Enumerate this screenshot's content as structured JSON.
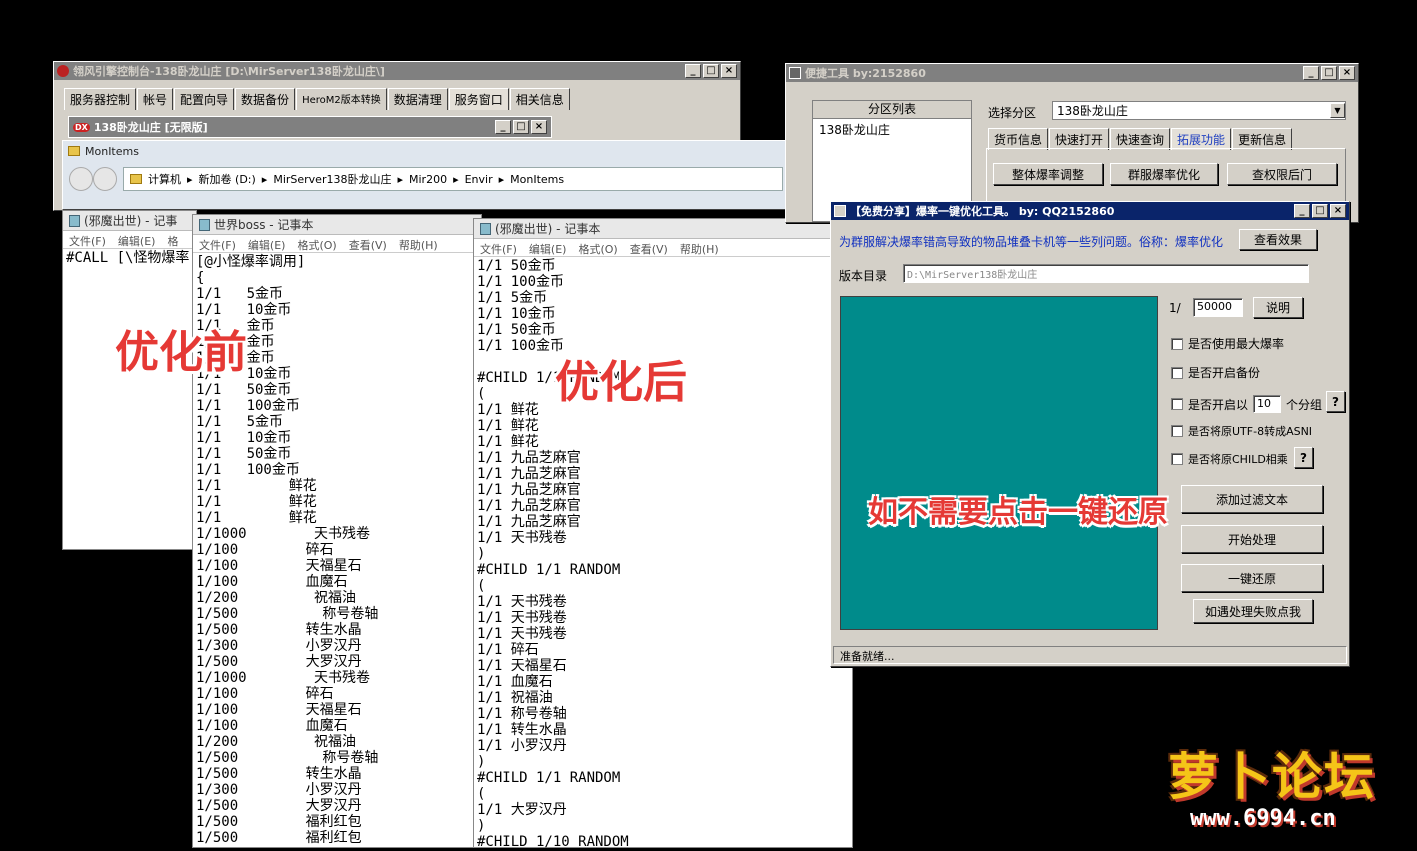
{
  "console": {
    "title": "翎风引擎控制台-138卧龙山庄 [D:\\MirServer138卧龙山庄\\]",
    "tabs": [
      "服务器控制",
      "帐号",
      "配置向导",
      "数据备份",
      "HeroM2版本转换",
      "数据清理",
      "服务窗口",
      "相关信息"
    ],
    "subwin_title": "138卧龙山庄 [无限版]",
    "subwin_icon": "DX"
  },
  "explorer": {
    "title": "MonItems",
    "path": [
      "计算机",
      "新加卷 (D:)",
      "MirServer138卧龙山庄",
      "Mir200",
      "Envir",
      "MonItems"
    ]
  },
  "notepad1": {
    "title": "(邪魔出世) - 记事",
    "menu": [
      "文件(F)",
      "编辑(E)",
      "格"
    ],
    "text": "#CALL [\\怪物爆率"
  },
  "notepad2": {
    "title": "世界boss - 记事本",
    "menu": [
      "文件(F)",
      "编辑(E)",
      "格式(O)",
      "查看(V)",
      "帮助(H)"
    ],
    "text": "[@小怪爆率调用]\n{\n1/1   5金币\n1/1   10金币\n1/1   金币\n1/1   金币\n1/1   金币\n1/1   10金币\n1/1   50金币\n1/1   100金币\n1/1   5金币\n1/1   10金币\n1/1   50金币\n1/1   100金币\n1/1        鲜花\n1/1        鲜花\n1/1        鲜花\n1/1000        天书残卷\n1/100        碎石\n1/100        天福星石\n1/100        血魔石\n1/200         祝福油\n1/500          称号卷轴\n1/500        转生水晶\n1/300        小罗汉丹\n1/500        大罗汉丹\n1/1000        天书残卷\n1/100        碎石\n1/100        天福星石\n1/100        血魔石\n1/200         祝福油\n1/500          称号卷轴\n1/500        转生水晶\n1/300        小罗汉丹\n1/500        大罗汉丹\n1/500        福利红包\n1/500        福利红包"
  },
  "notepad3": {
    "title": "(邪魔出世) - 记事本",
    "menu": [
      "文件(F)",
      "编辑(E)",
      "格式(O)",
      "查看(V)",
      "帮助(H)"
    ],
    "text": "1/1 50金币\n1/1 100金币\n1/1 5金币\n1/1 10金币\n1/1 50金币\n1/1 100金币\n\n#CHILD 1/1 RANDOM\n(\n1/1 鲜花\n1/1 鲜花\n1/1 鲜花\n1/1 九品芝麻官\n1/1 九品芝麻官\n1/1 九品芝麻官\n1/1 九品芝麻官\n1/1 九品芝麻官\n1/1 天书残卷\n)\n#CHILD 1/1 RANDOM\n(\n1/1 天书残卷\n1/1 天书残卷\n1/1 天书残卷\n1/1 碎石\n1/1 天福星石\n1/1 血魔石\n1/1 祝福油\n1/1 称号卷轴\n1/1 转生水晶\n1/1 小罗汉丹\n)\n#CHILD 1/1 RANDOM\n(\n1/1 大罗汉丹\n)\n#CHILD 1/10 RANDOM"
  },
  "quicktool": {
    "title": "便捷工具  by:2152860",
    "list_header": "分区列表",
    "list_items": [
      "138卧龙山庄"
    ],
    "select_label": "选择分区",
    "select_value": "138卧龙山庄",
    "tabs": [
      "货币信息",
      "快速打开",
      "快速查询",
      "拓展功能",
      "更新信息"
    ],
    "buttons": [
      "整体爆率调整",
      "群服爆率优化",
      "查权限后门"
    ]
  },
  "optimizer": {
    "title": "【免费分享】爆率一键优化工具。  by: QQ2152860",
    "description": "为群服解决爆率错高导致的物品堆叠卡机等一些列问题。俗称：爆率优化",
    "view_effect": "查看效果",
    "version_label": "版本目录",
    "version_path": "D:\\MirServer138卧龙山庄",
    "ratio_prefix": "1/",
    "ratio_value": "50000",
    "explain": "说明",
    "opt_max": "是否使用最大爆率",
    "opt_backup": "是否开启备份",
    "opt_group_a": "是否开启以",
    "opt_group_value": "10",
    "opt_group_b": "个分组",
    "opt_utf8": "是否将原UTF-8转成ASNI",
    "opt_child": "是否将原CHILD相乘",
    "help_q": "?",
    "btn_filter": "添加过滤文本",
    "btn_start": "开始处理",
    "btn_restore": "一键还原",
    "btn_fail": "如遇处理失败点我",
    "status": "准备就绪..."
  },
  "overlays": {
    "before": "优化前",
    "after": "优化后",
    "restore_hint": "如不需要点击一键还原"
  },
  "watermark": {
    "text": "萝卜论坛",
    "url": "www.6994.cn"
  },
  "colors": {
    "titlebar_active": "#0a246a",
    "teal_panel": "#008b8b",
    "overlay_red": "#e53935"
  }
}
